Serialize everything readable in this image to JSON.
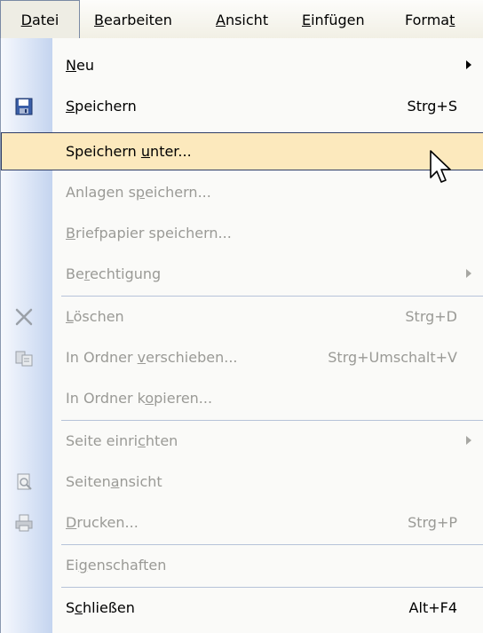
{
  "menubar": {
    "items": [
      {
        "pre": "",
        "u": "D",
        "post": "atei",
        "active": true
      },
      {
        "pre": "",
        "u": "B",
        "post": "earbeiten"
      },
      {
        "pre": "",
        "u": "A",
        "post": "nsicht"
      },
      {
        "pre": "",
        "u": "E",
        "post": "infügen"
      },
      {
        "pre": "Forma",
        "u": "t",
        "post": ""
      }
    ]
  },
  "menu": {
    "items": [
      {
        "pre": "",
        "u": "N",
        "post": "eu",
        "shortcut": "",
        "submenu": true,
        "disabled": false
      },
      {
        "pre": "",
        "u": "S",
        "post": "peichern",
        "shortcut": "Strg+S",
        "icon": "save-icon",
        "disabled": false
      },
      {
        "pre": "Speichern ",
        "u": "u",
        "post": "nter...",
        "shortcut": "",
        "highlighted": true,
        "disabled": false
      },
      {
        "pre": "Anlagen s",
        "u": "p",
        "post": "eichern...",
        "shortcut": "",
        "disabled": true
      },
      {
        "pre": "",
        "u": "B",
        "post": "riefpapier speichern...",
        "shortcut": "",
        "disabled": true
      },
      {
        "pre": "Be",
        "u": "r",
        "post": "echtigung",
        "shortcut": "",
        "submenu": true,
        "disabled": true
      },
      {
        "pre": "",
        "u": "L",
        "post": "öschen",
        "shortcut": "Strg+D",
        "icon": "delete-icon",
        "disabled": true
      },
      {
        "pre": "In Ordner ",
        "u": "v",
        "post": "erschieben...",
        "shortcut": "Strg+Umschalt+V",
        "icon": "move-to-folder-icon",
        "disabled": true
      },
      {
        "pre": "In Ordner k",
        "u": "o",
        "post": "pieren...",
        "shortcut": "",
        "disabled": true
      },
      {
        "pre": "Seite einri",
        "u": "c",
        "post": "hten",
        "shortcut": "",
        "submenu": true,
        "disabled": true
      },
      {
        "pre": "Seiten",
        "u": "a",
        "post": "nsicht",
        "shortcut": "",
        "icon": "print-preview-icon",
        "disabled": true
      },
      {
        "pre": "",
        "u": "D",
        "post": "rucken...",
        "shortcut": "Strg+P",
        "icon": "print-icon",
        "disabled": true
      },
      {
        "pre": "Ei",
        "u": "g",
        "post": "enschaften",
        "shortcut": "",
        "disabled": true
      },
      {
        "pre": "S",
        "u": "c",
        "post": "hließen",
        "shortcut": "Alt+F4",
        "disabled": false
      }
    ]
  }
}
